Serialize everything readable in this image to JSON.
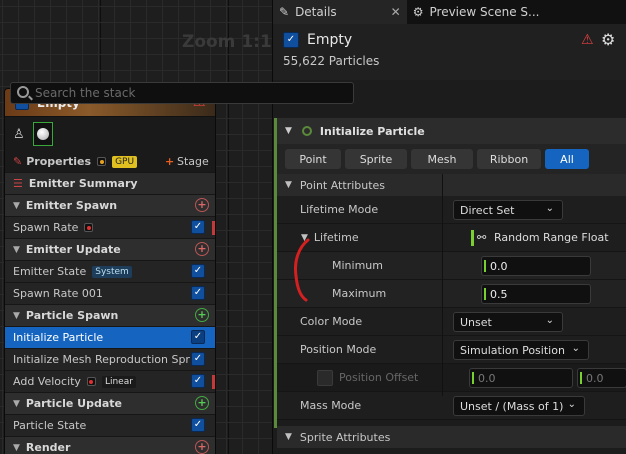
{
  "graph": {
    "zoom_label": "Zoom 1:1"
  },
  "node": {
    "title": "Empty",
    "properties_label": "Properties",
    "gpu_tag": "GPU",
    "stage_label": "Stage",
    "summary_label": "Emitter Summary",
    "sections": {
      "emitter_spawn": "Emitter Spawn",
      "emitter_update": "Emitter Update",
      "particle_spawn": "Particle Spawn",
      "particle_update": "Particle Update",
      "render": "Render"
    },
    "modules": {
      "spawn_rate": "Spawn Rate",
      "emitter_state": "Emitter State",
      "system_tag": "System",
      "spawn_rate_001": "Spawn Rate 001",
      "initialize_particle": "Initialize Particle",
      "init_mesh": "Initialize Mesh Reproduction Sprite",
      "add_velocity": "Add Velocity",
      "linear_tag": "Linear",
      "particle_state": "Particle State"
    }
  },
  "details": {
    "tab_details": "Details",
    "tab_preview": "Preview Scene S...",
    "asset_name": "Empty",
    "particle_count": "55,622 Particles",
    "search_placeholder": "Search the stack",
    "module_title": "Initialize Particle",
    "filters": [
      "Point",
      "Sprite",
      "Mesh",
      "Ribbon",
      "All"
    ],
    "point_attributes": "Point Attributes",
    "lifetime_mode_label": "Lifetime Mode",
    "lifetime_mode_value": "Direct Set",
    "lifetime_label": "Lifetime",
    "lifetime_value": "Random Range Float",
    "minimum_label": "Minimum",
    "minimum_value": "0.0",
    "maximum_label": "Maximum",
    "maximum_value": "0.5",
    "color_mode_label": "Color Mode",
    "color_mode_value": "Unset",
    "position_mode_label": "Position Mode",
    "position_mode_value": "Simulation Position",
    "position_offset_label": "Position Offset",
    "position_offset_x": "0.0",
    "position_offset_y": "0.0",
    "mass_mode_label": "Mass Mode",
    "mass_mode_value": "Unset / (Mass of 1)",
    "sprite_attributes": "Sprite Attributes"
  },
  "colors": {
    "accent": "#1565c0",
    "warning": "#e04040",
    "module_bar": "#5b8a3a",
    "annotation": "#d42020"
  }
}
